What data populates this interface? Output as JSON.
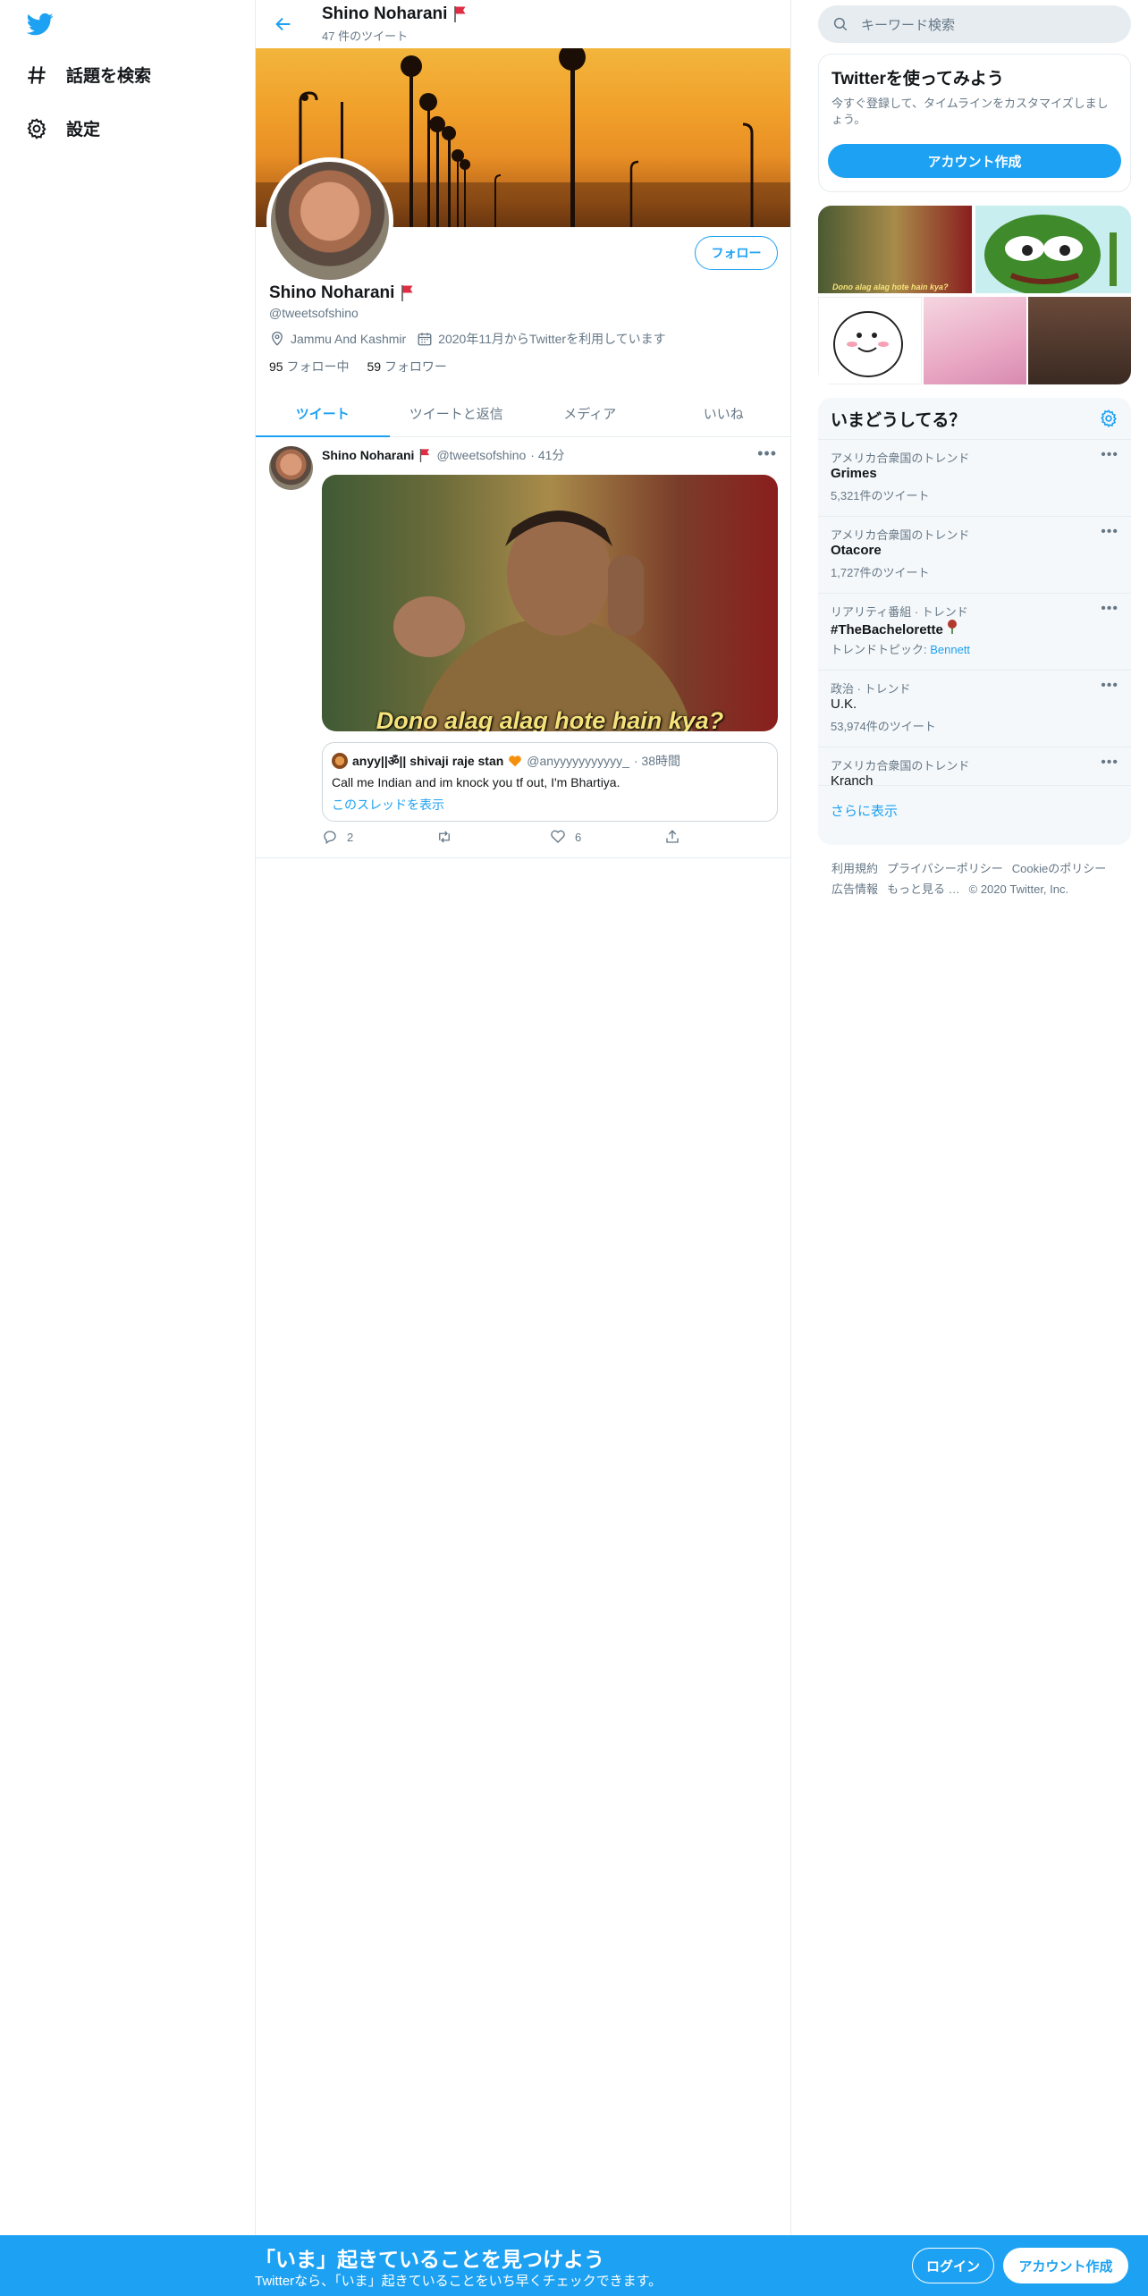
{
  "colors": {
    "accent": "#1da1f2",
    "text": "#14171a",
    "muted": "#657786",
    "border": "#e6ecf0"
  },
  "nav": {
    "logo_icon": "twitter-bird-icon",
    "items": [
      {
        "label": "話題を検索",
        "icon": "hashtag-icon"
      },
      {
        "label": "設定",
        "icon": "gear-icon"
      }
    ]
  },
  "header": {
    "name": "Shino Noharani",
    "tweet_count": "47 件のツイート"
  },
  "profile": {
    "name": "Shino Noharani",
    "handle": "@tweetsofshino",
    "location": "Jammu And Kashmir",
    "joined": "2020年11月からTwitterを利用しています",
    "following_count": "95",
    "following_label": "フォロー中",
    "followers_count": "59",
    "followers_label": "フォロワー",
    "follow_button": "フォロー"
  },
  "tabs": [
    "ツイート",
    "ツイートと返信",
    "メディア",
    "いいね"
  ],
  "tweet": {
    "name": "Shino Noharani",
    "handle": "@tweetsofshino",
    "time": "· 41分",
    "media_caption": "Dono alag alag hote hain kya?",
    "quote": {
      "name": "anyy||ॐ|| shivaji raje stan",
      "handle": "@anyyyyyyyyyyy_",
      "time": "· 38時間",
      "text": "Call me Indian and im knock you tf out, I'm Bhartiya.",
      "link": "このスレッドを表示"
    },
    "replies": "2",
    "retweets": "",
    "likes": "6"
  },
  "search": {
    "placeholder": "キーワード検索"
  },
  "signup_card": {
    "title": "Twitterを使ってみよう",
    "subtitle": "今すぐ登録して、タイムラインをカスタマイズしましょう。",
    "button": "アカウント作成"
  },
  "media_grid_caption": "Dono alag alag hote hain kya?",
  "trends": {
    "title": "いまどうしてる？",
    "items": [
      {
        "category": "アメリカ合衆国のトレンド",
        "name": "Grimes",
        "count": "5,321件のツイート"
      },
      {
        "category": "アメリカ合衆国のトレンド",
        "name": "Otacore",
        "count": "1,727件のツイート"
      },
      {
        "category": "リアリティ番組 · トレンド",
        "name": "#TheBachelorette",
        "count_prefix": "トレンドトピック: ",
        "count_link": "Bennett"
      },
      {
        "category": "政治 · トレンド",
        "name": "U.K.",
        "count": "53,974件のツイート"
      },
      {
        "category": "アメリカ合衆国のトレンド",
        "name": "Kranch"
      }
    ],
    "more": "さらに表示"
  },
  "footer": {
    "links": [
      "利用規約",
      "プライバシーポリシー",
      "Cookieのポリシー",
      "広告情報",
      "もっと見る …"
    ],
    "copyright": "© 2020 Twitter, Inc."
  },
  "bottom_bar": {
    "title": "「いま」起きていることを見つけよう",
    "subtitle": "Twitterなら、「いま」起きていることをいち早くチェックできます。",
    "login": "ログイン",
    "signup": "アカウント作成"
  }
}
